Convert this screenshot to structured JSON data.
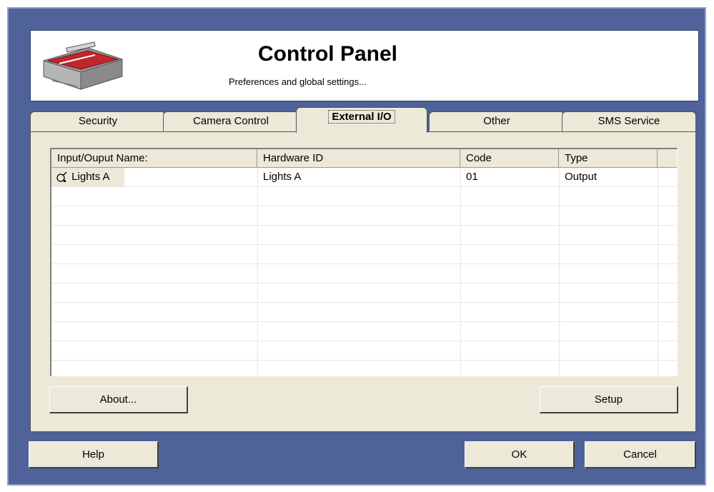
{
  "header": {
    "title": "Control Panel",
    "subtitle": "Preferences and global settings...",
    "logo_icon": "toolbox-icon"
  },
  "tabs": [
    {
      "label": "Security",
      "active": false
    },
    {
      "label": "Camera Control",
      "active": false
    },
    {
      "label": "External I/O",
      "active": true
    },
    {
      "label": "Other",
      "active": false
    },
    {
      "label": "SMS Service",
      "active": false
    }
  ],
  "table": {
    "columns": [
      "Input/Ouput Name:",
      "Hardware ID",
      "Code",
      "Type"
    ],
    "rows": [
      {
        "name": "Lights A",
        "hardware_id": "Lights A",
        "code": "01",
        "type": "Output",
        "icon": "io-output-icon"
      }
    ]
  },
  "panel_buttons": {
    "about": "About...",
    "setup": "Setup"
  },
  "footer_buttons": {
    "help": "Help",
    "ok": "OK",
    "cancel": "Cancel"
  },
  "colors": {
    "frame": "#4f6299",
    "panel": "#ece9d8"
  }
}
